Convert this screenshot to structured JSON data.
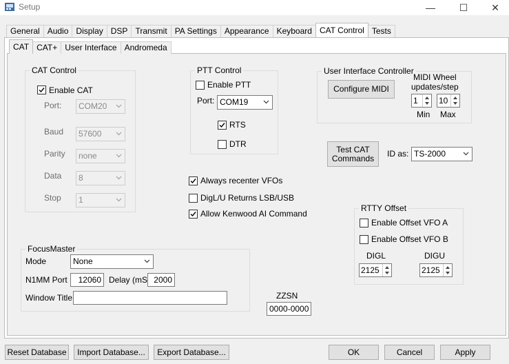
{
  "window": {
    "title": "Setup",
    "minimize_glyph": "—",
    "maximize_glyph": "☐",
    "close_glyph": "✕"
  },
  "top_tabs": [
    "General",
    "Audio",
    "Display",
    "DSP",
    "Transmit",
    "PA Settings",
    "Appearance",
    "Keyboard",
    "CAT Control",
    "Tests"
  ],
  "sub_tabs": [
    "CAT",
    "CAT+",
    "User Interface",
    "Andromeda"
  ],
  "cat_control": {
    "title": "CAT Control",
    "enable_label": "Enable CAT",
    "enabled": true,
    "port_label": "Port:",
    "port_value": "COM20",
    "baud_label": "Baud",
    "baud_value": "57600",
    "parity_label": "Parity",
    "parity_value": "none",
    "data_label": "Data",
    "data_value": "8",
    "stop_label": "Stop",
    "stop_value": "1"
  },
  "ptt_control": {
    "title": "PTT Control",
    "enable_label": "Enable PTT",
    "enabled": false,
    "port_label": "Port:",
    "port_value": "COM19",
    "rts_label": "RTS",
    "rts": true,
    "dtr_label": "DTR",
    "dtr": false
  },
  "ui_controller": {
    "title": "User Interface Controller",
    "configure_midi": "Configure MIDI",
    "midi_wheel_label_1": "MIDI  Wheel",
    "midi_wheel_label_2": "updates/step",
    "min_value": "1",
    "max_value": "10",
    "min_label": "Min",
    "max_label": "Max"
  },
  "test_cat": {
    "line1": "Test CAT",
    "line2": "Commands",
    "id_as_label": "ID as:",
    "id_as_value": "TS-2000"
  },
  "options": [
    {
      "label": "Always recenter VFOs",
      "checked": true
    },
    {
      "label": "DigL/U Returns LSB/USB",
      "checked": false
    },
    {
      "label": "Allow Kenwood AI Command",
      "checked": true
    }
  ],
  "rtty": {
    "title": "RTTY Offset",
    "vfo_a_label": "Enable Offset VFO A",
    "vfo_a": false,
    "vfo_b_label": "Enable Offset VFO B",
    "vfo_b": false,
    "digl_label": "DIGL",
    "digl_value": "2125",
    "digu_label": "DIGU",
    "digu_value": "2125"
  },
  "focusmaster": {
    "title": "FocusMaster",
    "mode_label": "Mode",
    "mode_value": "None",
    "n1mm_label": "N1MM Port",
    "n1mm_value": "12060",
    "delay_label": "Delay (mS)",
    "delay_value": "2000",
    "window_title_label": "Window Title",
    "window_title_value": ""
  },
  "zzsn": {
    "label": "ZZSN",
    "value": "0000-0000"
  },
  "footer": {
    "reset": "Reset Database",
    "import": "Import Database...",
    "export": "Export Database...",
    "ok": "OK",
    "cancel": "Cancel",
    "apply": "Apply"
  }
}
